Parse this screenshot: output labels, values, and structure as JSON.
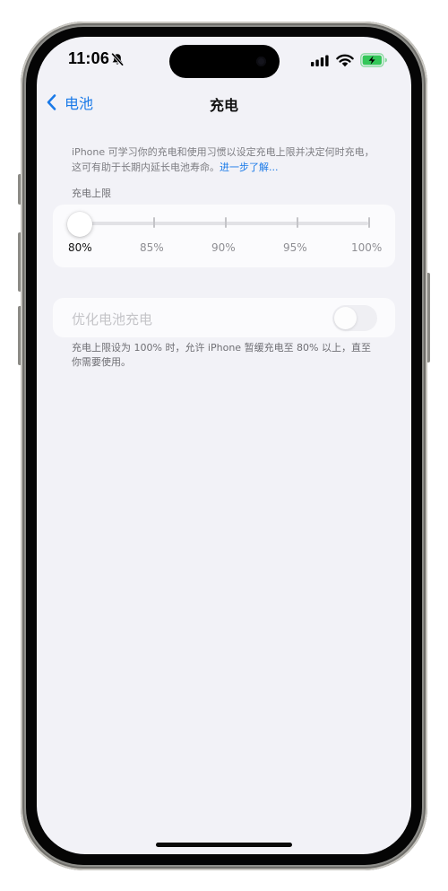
{
  "status_bar": {
    "time": "11:06",
    "silent_icon": "bell-slash-icon",
    "signal_icon": "cellular-signal-icon",
    "wifi_icon": "wifi-icon",
    "battery_icon": "battery-charging-icon",
    "battery_color": "#34c759"
  },
  "nav": {
    "back_label": "电池",
    "title": "充电",
    "accent_color": "#1a7ae8"
  },
  "description": {
    "text": "iPhone 可学习你的充电和使用习惯以设定充电上限并决定何时充电，这可有助于长期内延长电池寿命。",
    "link": "进一步了解..."
  },
  "charge_limit": {
    "label": "充电上限",
    "options": [
      "80%",
      "85%",
      "90%",
      "95%",
      "100%"
    ],
    "selected_index": 0,
    "selected_value": "80%"
  },
  "optimized_charging": {
    "label": "优化电池充电",
    "enabled": false,
    "disabled": true
  },
  "footer_note": "充电上限设为 100% 时，允许 iPhone 暂缓充电至 80% 以上，直至你需要使用。"
}
